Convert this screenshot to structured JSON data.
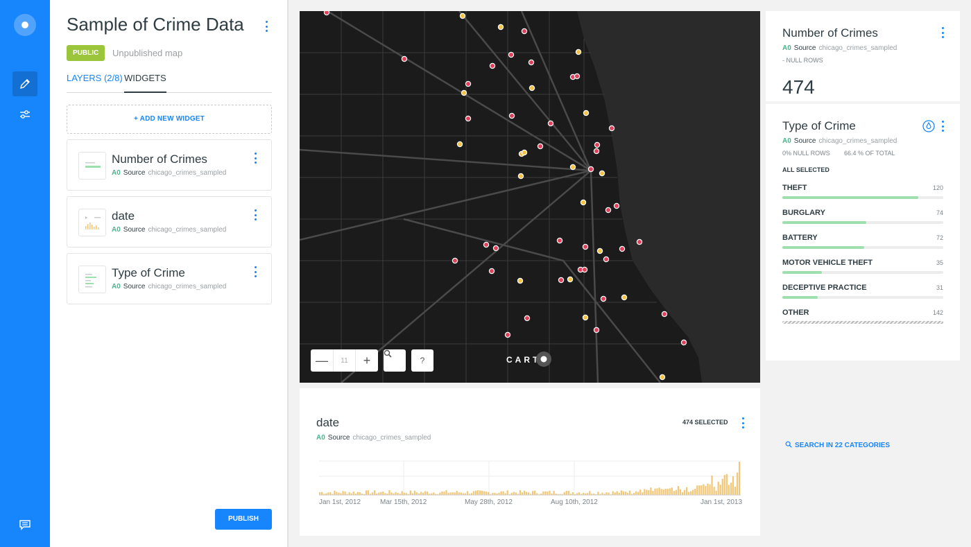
{
  "sidebar_rail": {
    "icons": [
      "carto-logo-icon",
      "pencil-icon",
      "sliders-icon",
      "chat-icon"
    ]
  },
  "panel": {
    "title": "Sample of Crime Data",
    "badge": "PUBLIC",
    "status": "Unpublished map",
    "tabs": [
      {
        "label": "LAYERS (2/8)"
      },
      {
        "label": "WIDGETS"
      }
    ],
    "add_widget": "+ ADD NEW WIDGET",
    "widgets": [
      {
        "title": "Number of Crimes",
        "layer": "A0",
        "source_label": "Source",
        "source": "chicago_crimes_sampled"
      },
      {
        "title": "date",
        "layer": "A0",
        "source_label": "Source",
        "source": "chicago_crimes_sampled"
      },
      {
        "title": "Type of Crime",
        "layer": "A0",
        "source_label": "Source",
        "source": "chicago_crimes_sampled"
      }
    ],
    "publish": "PUBLISH"
  },
  "map": {
    "zoom_level": "11",
    "zoom_out": "—",
    "zoom_in": "+",
    "search_icon": "search-icon",
    "help": "?",
    "brand": "CART"
  },
  "number_widget": {
    "title": "Number of Crimes",
    "layer": "A0",
    "source_label": "Source",
    "source": "chicago_crimes_sampled",
    "null_rows": "- NULL ROWS",
    "value": "474"
  },
  "type_widget": {
    "title": "Type of Crime",
    "layer": "A0",
    "source_label": "Source",
    "source": "chicago_crimes_sampled",
    "null_rows": "0% NULL ROWS",
    "pct_total": "66.4 % OF TOTAL",
    "all_selected": "ALL SELECTED",
    "categories": [
      {
        "name": "THEFT",
        "count": "120",
        "value": 120
      },
      {
        "name": "BURGLARY",
        "count": "74",
        "value": 74
      },
      {
        "name": "BATTERY",
        "count": "72",
        "value": 72
      },
      {
        "name": "MOTOR VEHICLE THEFT",
        "count": "35",
        "value": 35
      },
      {
        "name": "DECEPTIVE PRACTICE",
        "count": "31",
        "value": 31
      },
      {
        "name": "OTHER",
        "count": "142",
        "value": 142
      }
    ],
    "search": "SEARCH IN 22 CATEGORIES"
  },
  "date_widget": {
    "title": "date",
    "layer": "A0",
    "source_label": "Source",
    "source": "chicago_crimes_sampled",
    "selected": "474 SELECTED",
    "ticks": [
      "Jan 1st, 2012",
      "Mar 15th, 2012",
      "May 28th, 2012",
      "Aug 10th, 2012",
      "Jan 1st, 2013"
    ]
  },
  "colors": {
    "accent": "#1785fb",
    "public_badge": "#9bc63b",
    "layer_tag": "#4cb38c",
    "bar_fill": "#9de0ad",
    "histogram": "#f2c777",
    "point_red": "#e0405a",
    "point_yellow": "#f5c243",
    "map_bg": "#1b1b1b",
    "water": "#2a2a2a"
  }
}
